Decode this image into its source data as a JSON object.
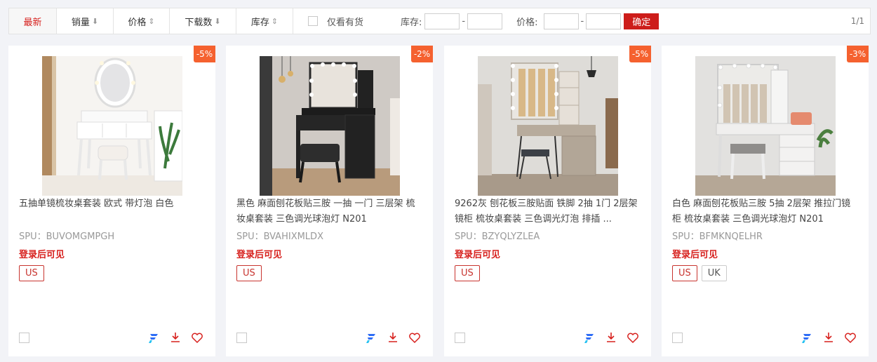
{
  "toolbar": {
    "sort_newest": "最新",
    "sort_sales": "销量",
    "sort_price": "价格",
    "sort_downloads": "下载数",
    "sort_stock": "库存",
    "in_stock_only": "仅看有货",
    "stock_label": "库存:",
    "price_label": "价格:",
    "stock_min": "",
    "stock_max": "",
    "price_min": "",
    "price_max": "",
    "range_dash": "-",
    "confirm_label": "确定",
    "page_indicator": "1/1"
  },
  "colors": {
    "accent": "#d7201d",
    "badge": "#f5612f",
    "background": "#f2f3f7"
  },
  "products": [
    {
      "discount": "-5%",
      "title": "五抽单镜梳妆桌套装 欧式 带灯泡 白色",
      "spu": "SPU：BUVOMGMPGH",
      "price_text": "登录后可见",
      "tags": [
        "US"
      ]
    },
    {
      "discount": "-2%",
      "title": "黑色 麻面刨花板贴三胺 一抽 一门 三层架 梳妆桌套装 三色调光球泡灯 N201",
      "spu": "SPU：BVAHIXMLDX",
      "price_text": "登录后可见",
      "tags": [
        "US"
      ]
    },
    {
      "discount": "-5%",
      "title": "9262灰 刨花板三胺贴面 铁脚 2抽 1门 2层架 镜柜 梳妆桌套装 三色调光灯泡 排插 ...",
      "spu": "SPU：BZYQLYZLEA",
      "price_text": "登录后可见",
      "tags": [
        "US"
      ]
    },
    {
      "discount": "-3%",
      "title": "白色 麻面刨花板贴三胺 5抽 2层架 推拉门镜柜 梳妆桌套装 三色调光球泡灯 N201",
      "spu": "SPU：BFMKNQELHR",
      "price_text": "登录后可见",
      "tags": [
        "US",
        "UK"
      ]
    }
  ]
}
